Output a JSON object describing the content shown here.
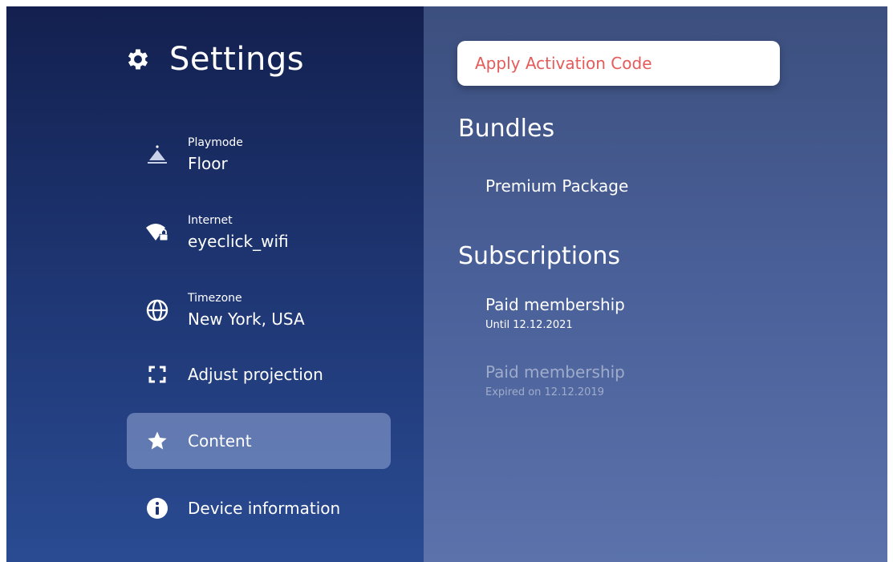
{
  "sidebar": {
    "title": "Settings",
    "title_icon": "gear-icon",
    "items": [
      {
        "icon": "playmode-icon",
        "label": "Playmode",
        "value": "Floor"
      },
      {
        "icon": "wifi-lock-icon",
        "label": "Internet",
        "value": "eyeclick_wifi"
      },
      {
        "icon": "globe-icon",
        "label": "Timezone",
        "value": "New York, USA"
      },
      {
        "icon": "projection-corners-icon",
        "label": "Adjust projection"
      },
      {
        "icon": "star-icon",
        "label": "Content",
        "active": true
      },
      {
        "icon": "info-icon",
        "label": "Device information"
      }
    ]
  },
  "main": {
    "activation_button": "Apply Activation Code",
    "bundles": {
      "title": "Bundles",
      "items": [
        {
          "name": "Premium Package"
        }
      ]
    },
    "subscriptions": {
      "title": "Subscriptions",
      "items": [
        {
          "name": "Paid membership",
          "status": "Until 12.12.2021",
          "expired": false
        },
        {
          "name": "Paid membership",
          "status": "Expired on 12.12.2019",
          "expired": true
        }
      ]
    }
  },
  "colors": {
    "accent_red": "#e65a5a",
    "sidebar_top": "#13204f",
    "content_bg": "#4a6099",
    "active_item_bg": "#96aad7"
  }
}
